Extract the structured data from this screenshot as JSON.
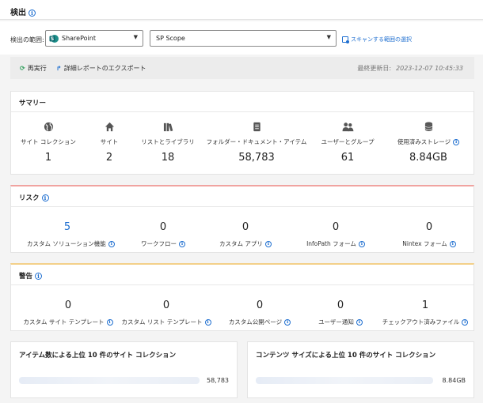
{
  "header": {
    "title": "検出"
  },
  "filter": {
    "scope_label": "検出の範囲:",
    "source_select": "SharePoint",
    "scope_select": "SP Scope",
    "scan_link": "スキャンする範囲の選択"
  },
  "actions": {
    "rerun": "再実行",
    "export": "詳細レポートのエクスポート",
    "updated_label": "最終更新日:",
    "updated_value": "2023-12-07 10:45:33"
  },
  "summary": {
    "title": "サマリー",
    "items": [
      {
        "icon": "globe-icon",
        "label": "サイト コレクション",
        "value": "1"
      },
      {
        "icon": "home-icon",
        "label": "サイト",
        "value": "2"
      },
      {
        "icon": "library-icon",
        "label": "リストとライブラリ",
        "value": "18"
      },
      {
        "icon": "document-icon",
        "label": "フォルダー・ドキュメント・アイテム",
        "value": "58,783"
      },
      {
        "icon": "users-icon",
        "label": "ユーザーとグループ",
        "value": "61"
      },
      {
        "icon": "database-icon",
        "label": "使用済みストレージ",
        "value": "8.84GB"
      }
    ]
  },
  "risk": {
    "title": "リスク",
    "items": [
      {
        "label": "カスタム ソリューション機能",
        "value": "5"
      },
      {
        "label": "ワークフロー",
        "value": "0"
      },
      {
        "label": "カスタム アプリ",
        "value": "0"
      },
      {
        "label": "InfoPath フォーム",
        "value": "0"
      },
      {
        "label": "Nintex フォーム",
        "value": "0"
      }
    ]
  },
  "warning": {
    "title": "警告",
    "items": [
      {
        "label": "カスタム サイト テンプレート",
        "value": "0"
      },
      {
        "label": "カスタム リスト テンプレート",
        "value": "0"
      },
      {
        "label": "カスタム公開ページ",
        "value": "0"
      },
      {
        "label": "ユーザー通知",
        "value": "0"
      },
      {
        "label": "チェックアウト済みファイル",
        "value": "1"
      }
    ]
  },
  "top_by_items": {
    "title": "アイテム数による上位 10 件のサイト コレクション",
    "row_value": "58,783"
  },
  "top_by_size": {
    "title": "コンテンツ サイズによる上位 10 件のサイト コレクション",
    "row_value": "8.84GB"
  },
  "colors": {
    "accent": "#1f6fd0",
    "risk_line": "#f0a3a0",
    "warning_line": "#f3d089",
    "rerun_icon": "#2f9e5b"
  }
}
